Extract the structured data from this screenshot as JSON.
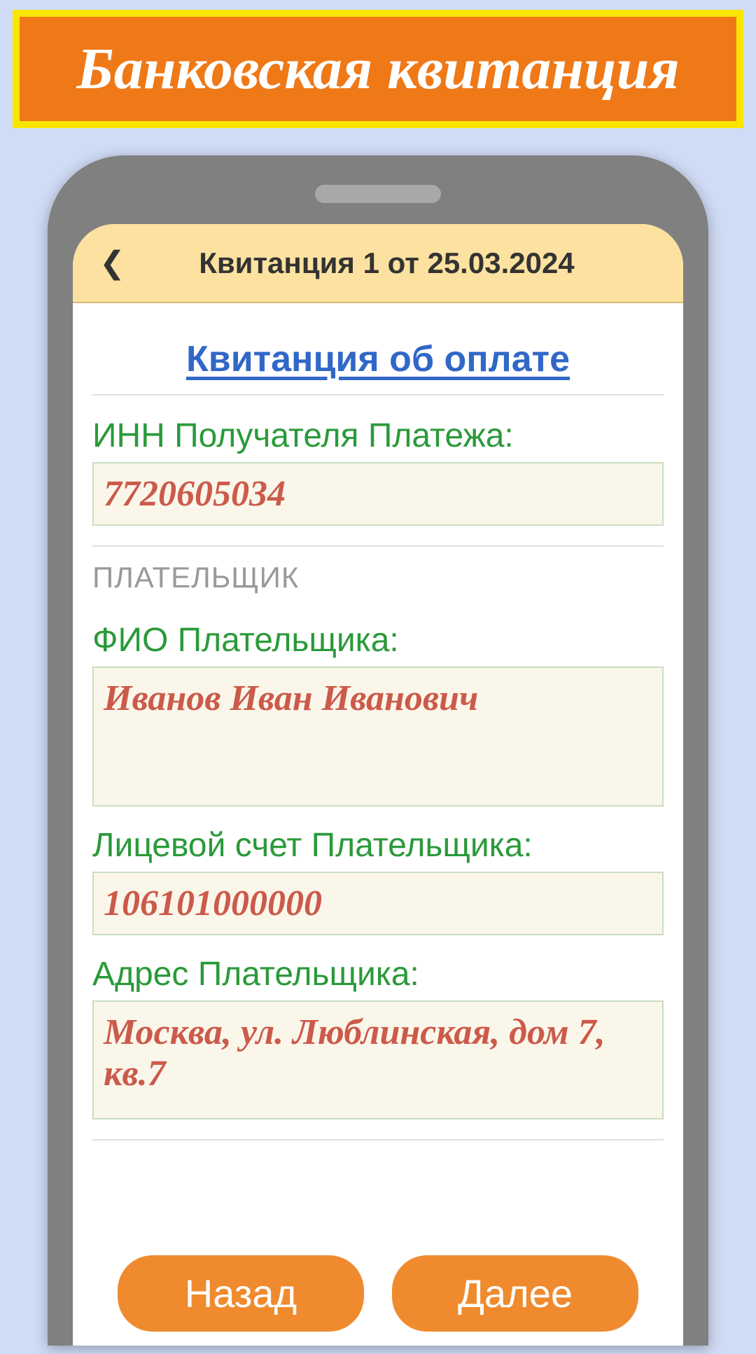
{
  "banner": {
    "title": "Банковская квитанция"
  },
  "header": {
    "title": "Квитанция 1 от 25.03.2024"
  },
  "page": {
    "title": "Квитанция об оплате"
  },
  "fields": {
    "inn": {
      "label": "ИНН Получателя Платежа:",
      "value": "7720605034"
    },
    "payer_section": "ПЛАТЕЛЬЩИК",
    "fio": {
      "label": "ФИО Плательщика:",
      "value": "Иванов Иван Иванович"
    },
    "account": {
      "label": "Лицевой счет Плательщика:",
      "value": "106101000000"
    },
    "address": {
      "label": "Адрес Плательщика:",
      "value": "Москва, ул. Люблинская, дом 7, кв.7"
    }
  },
  "buttons": {
    "back": "Назад",
    "next": "Далее"
  }
}
